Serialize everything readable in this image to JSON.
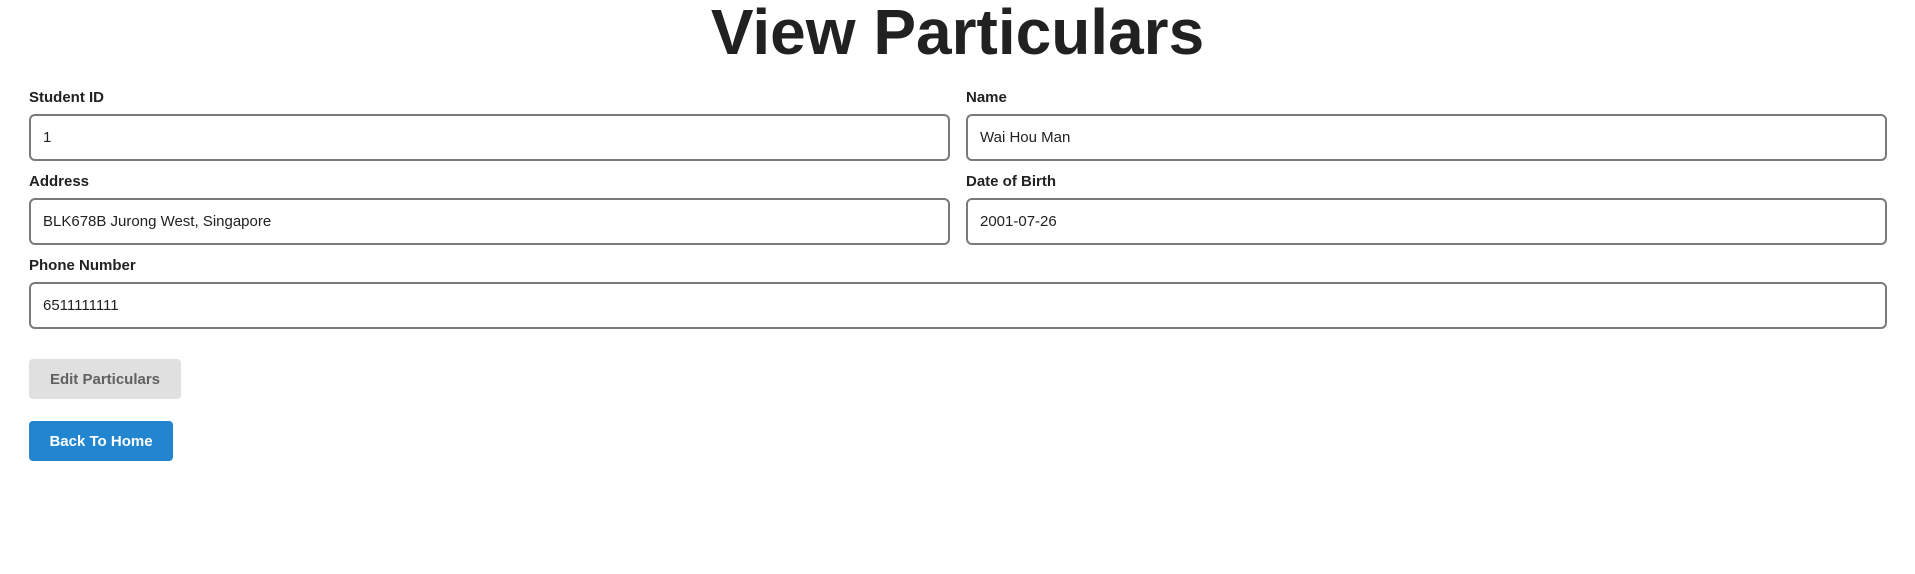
{
  "page": {
    "title": "View Particulars"
  },
  "form": {
    "student_id": {
      "label": "Student ID",
      "value": "1"
    },
    "name": {
      "label": "Name",
      "value": "Wai Hou Man"
    },
    "address": {
      "label": "Address",
      "value": "BLK678B Jurong West, Singapore"
    },
    "dob": {
      "label": "Date of Birth",
      "value": "2001-07-26"
    },
    "phone": {
      "label": "Phone Number",
      "value": "6511111111"
    }
  },
  "actions": {
    "edit_label": "Edit Particulars",
    "home_label": "Back To Home"
  },
  "colors": {
    "primary": "#2185d0",
    "disabled_bg": "#e0e0e0",
    "disabled_text": "#616161",
    "border": "#7a7a7a",
    "text": "#212121"
  }
}
